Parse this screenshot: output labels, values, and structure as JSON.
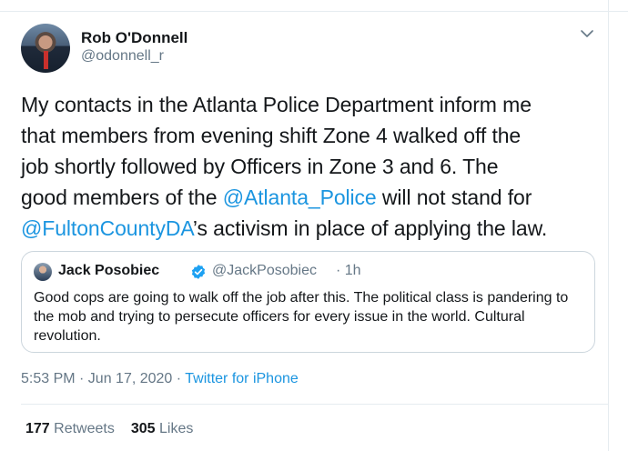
{
  "author": {
    "name": "Rob O'Donnell",
    "handle": "@odonnell_r"
  },
  "tweet": {
    "lines": [
      "My contacts in the Atlanta Police Department inform me",
      "that members from evening shift Zone 4 walked off the",
      "job shortly followed by Officers in Zone 3 and 6. The"
    ],
    "line4_pre": "good members of the ",
    "mention1": "@Atlanta_Police",
    "line4_post": " will not stand for",
    "mention2": "@FultonCountyDA",
    "line5_post": "’s activism in place of applying the law."
  },
  "quoted": {
    "name": "Jack Posobiec",
    "handle": "@JackPosobiec",
    "time": "· 1h",
    "text": "Good cops are going to walk off the job after this. The political class is pandering to the mob and trying to persecute officers for every issue in the world. Cultural revolution."
  },
  "meta": {
    "time": "5:53 PM · Jun 17, 2020 · ",
    "source": "Twitter for iPhone"
  },
  "stats": {
    "retweets_count": "177",
    "retweets_label": " Retweets",
    "likes_count": "305",
    "likes_label": " Likes"
  },
  "icons": {
    "menu": "chevron-down-icon",
    "verified": "verified-badge-icon"
  },
  "colors": {
    "link": "#1b95e0",
    "secondary_text": "#657786",
    "border": "#ccd6dd"
  }
}
